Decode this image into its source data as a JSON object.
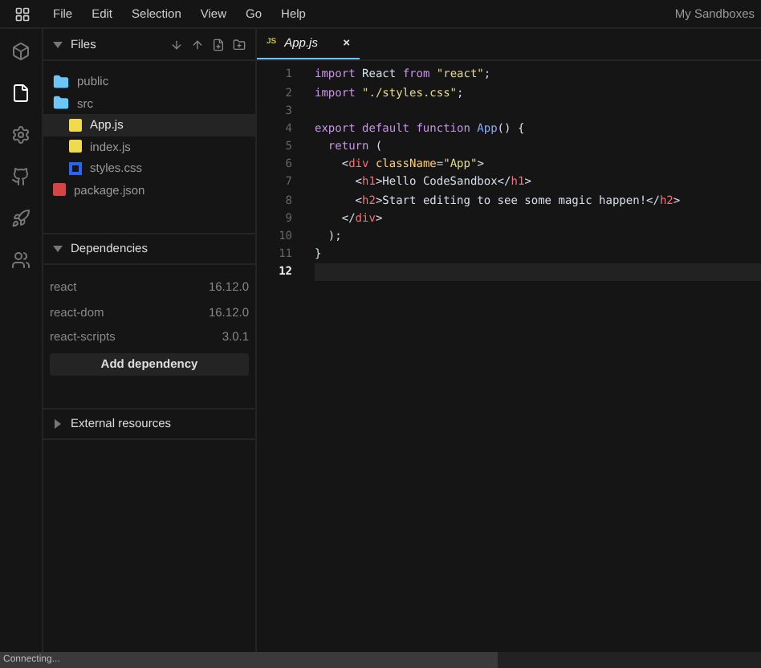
{
  "menu": [
    "File",
    "Edit",
    "Selection",
    "View",
    "Go",
    "Help"
  ],
  "account": "My Sandboxes",
  "activity_bar": [
    {
      "kind": "cube",
      "selected": false
    },
    {
      "kind": "file",
      "selected": true
    },
    {
      "kind": "gear",
      "selected": false
    },
    {
      "kind": "github",
      "selected": false
    },
    {
      "kind": "rocket",
      "selected": false
    },
    {
      "kind": "users",
      "selected": false
    }
  ],
  "files": {
    "title": "Files",
    "expanded": true,
    "tree": [
      {
        "name": "public",
        "kind": "folder",
        "selected": false
      },
      {
        "name": "src",
        "kind": "folder",
        "selected": false,
        "children": [
          {
            "name": "App.js",
            "kind": "js",
            "selected": true
          },
          {
            "name": "index.js",
            "kind": "js",
            "selected": false
          },
          {
            "name": "styles.css",
            "kind": "css",
            "selected": false
          }
        ]
      },
      {
        "name": "package.json",
        "kind": "json",
        "selected": false
      }
    ]
  },
  "dependencies": {
    "title": "Dependencies",
    "expanded": true,
    "items": [
      {
        "name": "react",
        "version": "16.12.0"
      },
      {
        "name": "react-dom",
        "version": "16.12.0"
      },
      {
        "name": "react-scripts",
        "version": "3.0.1"
      }
    ],
    "button": "Add dependency"
  },
  "external": {
    "title": "External resources",
    "expanded": false
  },
  "tab": {
    "badge": "JS",
    "label": "App.js",
    "close": "×"
  },
  "code": [
    {
      "number": "1",
      "active": false,
      "tokens": [
        {
          "kind": "keyword",
          "text": "import"
        },
        {
          "kind": "plain",
          "text": " React "
        },
        {
          "kind": "keyword",
          "text": "from"
        },
        {
          "kind": "string",
          "text": " \"react\""
        },
        {
          "kind": "plain",
          "text": ";"
        }
      ]
    },
    {
      "number": "2",
      "active": false,
      "tokens": [
        {
          "kind": "keyword",
          "text": "import"
        },
        {
          "kind": "string",
          "text": " \"./styles.css\""
        },
        {
          "kind": "plain",
          "text": ";"
        }
      ]
    },
    {
      "number": "3",
      "active": false
    },
    {
      "number": "4",
      "active": false,
      "tokens": [
        {
          "kind": "keyword",
          "text": "export default function"
        },
        {
          "kind": "func",
          "text": " App"
        },
        {
          "kind": "plain",
          "text": "() {"
        }
      ]
    },
    {
      "number": "5",
      "active": false,
      "tokens": [
        {
          "kind": "keyword",
          "text": "  return"
        },
        {
          "kind": "plain",
          "text": " ("
        }
      ]
    },
    {
      "number": "6",
      "active": false,
      "tokens": [
        {
          "kind": "plain",
          "text": "    <"
        },
        {
          "kind": "tag",
          "text": "div"
        },
        {
          "kind": "attr",
          "text": " className"
        },
        {
          "kind": "plain",
          "text": "="
        },
        {
          "kind": "string",
          "text": "\"App\""
        },
        {
          "kind": "plain",
          "text": ">"
        }
      ]
    },
    {
      "number": "7",
      "active": false,
      "tokens": [
        {
          "kind": "plain",
          "text": "      <"
        },
        {
          "kind": "tag",
          "text": "h1"
        },
        {
          "kind": "plain",
          "text": ">Hello CodeSandbox</"
        },
        {
          "kind": "tag",
          "text": "h1"
        },
        {
          "kind": "plain",
          "text": ">"
        }
      ]
    },
    {
      "number": "8",
      "active": false,
      "tokens": [
        {
          "kind": "plain",
          "text": "      <"
        },
        {
          "kind": "tag",
          "text": "h2"
        },
        {
          "kind": "plain",
          "text": ">Start editing to see some magic happen!</"
        },
        {
          "kind": "tag",
          "text": "h2"
        },
        {
          "kind": "plain",
          "text": ">"
        }
      ]
    },
    {
      "number": "9",
      "active": false,
      "tokens": [
        {
          "kind": "plain",
          "text": "    </"
        },
        {
          "kind": "tag",
          "text": "div"
        },
        {
          "kind": "plain",
          "text": ">"
        }
      ]
    },
    {
      "number": "10",
      "active": false,
      "tokens": [
        {
          "kind": "plain",
          "text": "  );"
        }
      ]
    },
    {
      "number": "11",
      "active": false,
      "tokens": [
        {
          "kind": "plain",
          "text": "}"
        }
      ]
    },
    {
      "number": "12",
      "active": true
    }
  ],
  "status": "Connecting..."
}
